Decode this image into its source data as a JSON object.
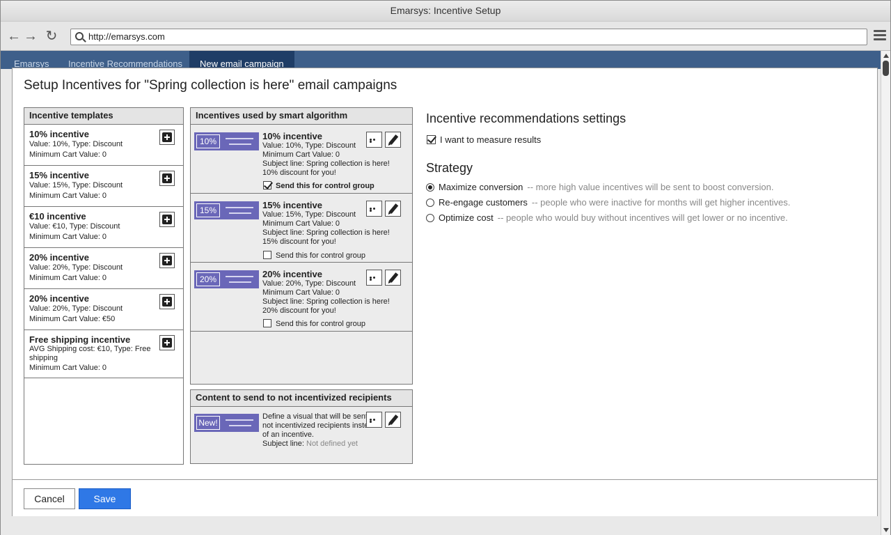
{
  "window": {
    "title": "Emarsys: Incentive Setup"
  },
  "browser": {
    "url": "http://emarsys.com"
  },
  "app_tabs": [
    {
      "label": "Emarsys"
    },
    {
      "label": "Incentive Recommendations"
    },
    {
      "label": "New email campaign"
    }
  ],
  "dialog": {
    "title": "Setup Incentives for \"Spring collection is here\" email campaigns",
    "templates_panel": {
      "header": "Incentive templates",
      "items": [
        {
          "name": "10% incentive",
          "line1": "Value: 10%, Type: Discount",
          "line2": "Minimum Cart Value: 0"
        },
        {
          "name": "15% incentive",
          "line1": "Value: 15%, Type: Discount",
          "line2": "Minimum Cart Value: 0"
        },
        {
          "name": "€10 incentive",
          "line1": "Value: €10, Type: Discount",
          "line2": "Minimum Cart Value: 0"
        },
        {
          "name": "20% incentive",
          "line1": "Value: 20%, Type: Discount",
          "line2": "Minimum Cart Value: 0"
        },
        {
          "name": "20% incentive",
          "line1": "Value: 20%, Type: Discount",
          "line2": "Minimum Cart Value: €50"
        },
        {
          "name": "Free shipping incentive",
          "line1": "AVG Shipping cost: €10, Type: Free shipping",
          "line2": "Minimum Cart Value: 0"
        }
      ]
    },
    "smart_panel": {
      "header": "Incentives used by smart algorithm",
      "items": [
        {
          "badge": "10%",
          "name": "10% incentive",
          "line1": "Value: 10%, Type: Discount",
          "line2": "Minimum Cart Value: 0",
          "subject": "Subject line: Spring collection is here!",
          "subject2": "10% discount for you!",
          "control_label": "Send this for control group",
          "control_checked": true
        },
        {
          "badge": "15%",
          "name": "15% incentive",
          "line1": "Value: 15%, Type: Discount",
          "line2": "Minimum Cart Value: 0",
          "subject": "Subject line: Spring collection is here!",
          "subject2": "15% discount for you!",
          "control_label": "Send this for control group",
          "control_checked": false
        },
        {
          "badge": "20%",
          "name": "20% incentive",
          "line1": "Value: 20%, Type: Discount",
          "line2": "Minimum Cart Value: 0",
          "subject": "Subject line: Spring collection is here!",
          "subject2": "20% discount for you!",
          "control_label": "Send this for control group",
          "control_checked": false
        }
      ]
    },
    "non_incentivized_panel": {
      "header": "Content to send to not incentivized recipients",
      "badge": "New!",
      "description": "Define a visual that will be sent for not incentivized recipients instead of an incentive.",
      "subject_label": "Subject line:",
      "subject_value": "Not defined yet"
    },
    "settings": {
      "title": "Incentive recommendations settings",
      "measure_label": "I want to measure results",
      "measure_checked": true,
      "strategy_title": "Strategy",
      "strategies": [
        {
          "label": "Maximize conversion",
          "desc": "-- more high value incentives will be sent to boost conversion.",
          "selected": true
        },
        {
          "label": "Re-engage customers",
          "desc": "-- people who were inactive for months will get higher incentives.",
          "selected": false
        },
        {
          "label": "Optimize cost",
          "desc": "-- people who would buy without incentives will get lower or no incentive.",
          "selected": false
        }
      ]
    },
    "footer": {
      "cancel_label": "Cancel",
      "save_label": "Save"
    }
  },
  "icons": {
    "back": "arrow-left-icon",
    "forward": "arrow-right-icon",
    "reload": "reload-icon",
    "search": "search-icon",
    "menu": "hamburger-menu-icon",
    "add": "plus-square-icon",
    "more": "ellipsis-icon",
    "edit": "pencil-icon"
  },
  "colors": {
    "app_bar": "#3e5f8a",
    "active_tab": "#1f3d66",
    "banner": "#6a67b8",
    "save_button": "#2f78e6"
  }
}
